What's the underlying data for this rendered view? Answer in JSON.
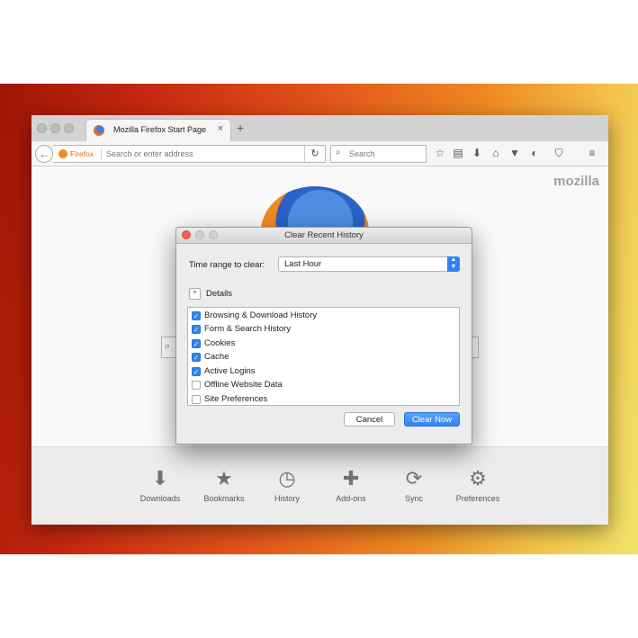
{
  "browser": {
    "tab_title": "Mozilla Firefox Start Page",
    "tab_close": "×",
    "new_tab": "+",
    "url_identity": "Firefox",
    "url_placeholder": "Search or enter address",
    "search_placeholder": "Search",
    "brand_text": "mozilla"
  },
  "launcher": {
    "items": [
      {
        "label": "Downloads",
        "icon": "download-icon",
        "glyph": "⬇"
      },
      {
        "label": "Bookmarks",
        "icon": "star-icon",
        "glyph": "★"
      },
      {
        "label": "History",
        "icon": "clock-icon",
        "glyph": "◷"
      },
      {
        "label": "Add-ons",
        "icon": "puzzle-icon",
        "glyph": "✚"
      },
      {
        "label": "Sync",
        "icon": "sync-icon",
        "glyph": "⟳"
      },
      {
        "label": "Preferences",
        "icon": "gear-icon",
        "glyph": "⚙"
      }
    ]
  },
  "dialog": {
    "title": "Clear Recent History",
    "time_range_label": "Time range to clear:",
    "time_range_value": "Last Hour",
    "details_label": "Details",
    "items": [
      {
        "label": "Browsing & Download History",
        "checked": true
      },
      {
        "label": "Form & Search History",
        "checked": true
      },
      {
        "label": "Cookies",
        "checked": true
      },
      {
        "label": "Cache",
        "checked": true
      },
      {
        "label": "Active Logins",
        "checked": true
      },
      {
        "label": "Offline Website Data",
        "checked": false
      },
      {
        "label": "Site Preferences",
        "checked": false
      }
    ],
    "cancel_label": "Cancel",
    "clear_label": "Clear Now"
  },
  "colors": {
    "accent": "#2f83f0",
    "firefox_orange": "#e76a13"
  }
}
